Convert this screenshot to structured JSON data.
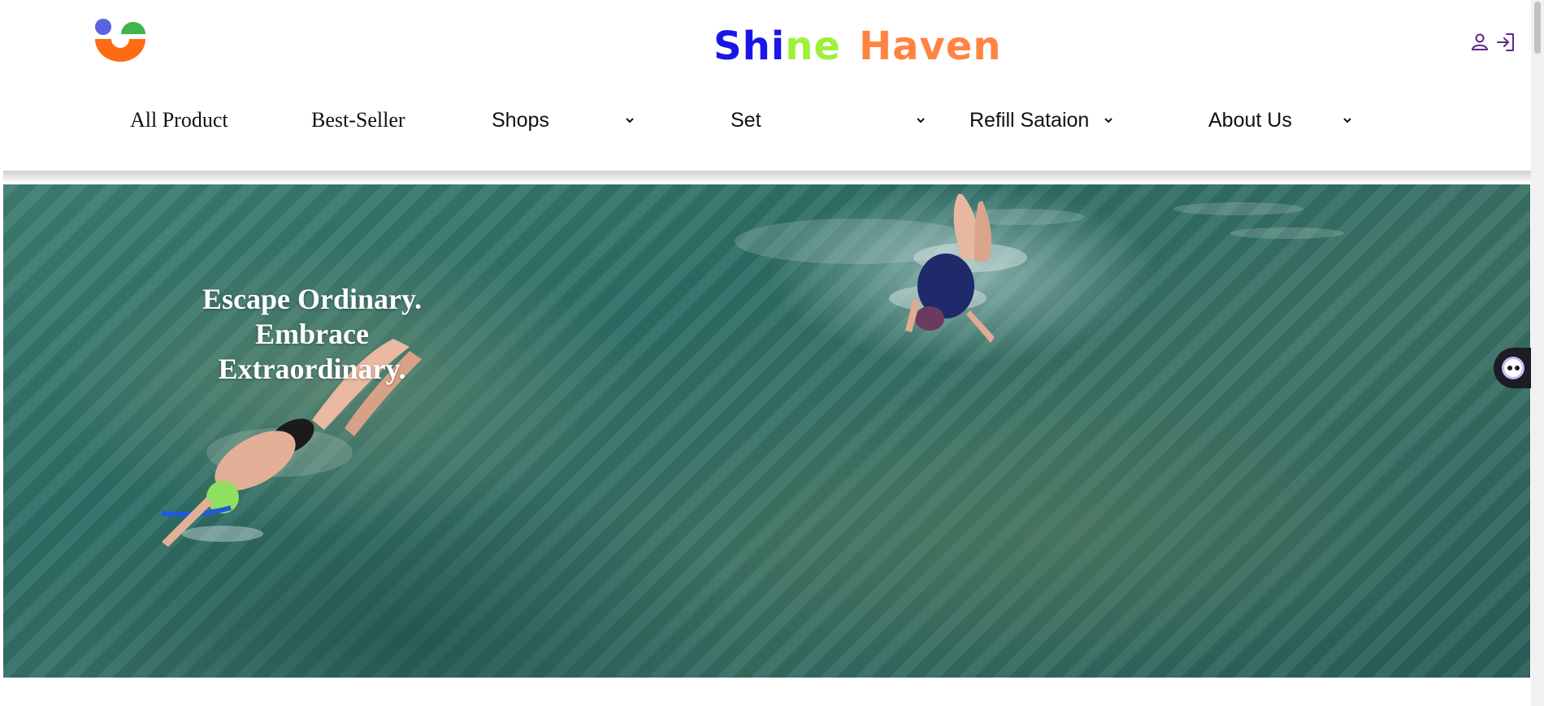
{
  "header": {
    "brand_part1": "Shi",
    "brand_part2": "ne",
    "brand_part3": "Haven",
    "brand_colors": [
      "#1a16e6",
      "#9ef03a",
      "#ff8443"
    ],
    "logo_icon": "smile-logo-icon",
    "account_icon": "user-icon",
    "login_icon": "sign-in-icon",
    "icon_color": "#5b2a86"
  },
  "nav": {
    "items": [
      {
        "label": "All Product",
        "has_dropdown": false
      },
      {
        "label": "Best-Seller",
        "has_dropdown": false
      },
      {
        "label": "Shops",
        "has_dropdown": true
      },
      {
        "label": "Set",
        "has_dropdown": true
      },
      {
        "label": "Refill Sataion",
        "has_dropdown": true
      },
      {
        "label": "About Us",
        "has_dropdown": true
      }
    ]
  },
  "hero": {
    "tagline": [
      "Escape Ordinary.",
      "Embrace",
      "Extraordinary."
    ]
  },
  "chat_widget": {
    "icon": "chat-bot-icon"
  }
}
